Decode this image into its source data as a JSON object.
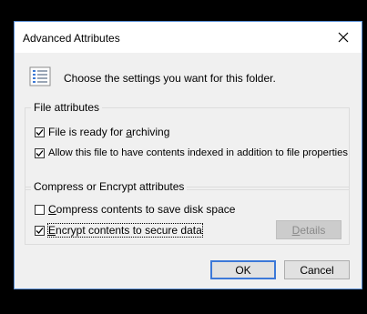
{
  "dialog": {
    "title": "Advanced Attributes",
    "header_text": "Choose the settings you want for this folder."
  },
  "file_attributes": {
    "label": "File attributes",
    "archive": {
      "label_pre": "File is ready for ",
      "label_ul": "a",
      "label_post": "rchiving",
      "checked": true
    },
    "index": {
      "label": "Allow this file to have contents indexed in addition to file properties",
      "checked": true
    }
  },
  "compress_encrypt": {
    "label": "Compress or Encrypt attributes",
    "compress": {
      "label_ul": "C",
      "label_post": "ompress contents to save disk space",
      "checked": false
    },
    "encrypt": {
      "label_ul": "E",
      "label_post": "ncrypt contents to secure data",
      "checked": true
    },
    "details_ul": "D",
    "details_post": "etails"
  },
  "buttons": {
    "ok": "OK",
    "cancel": "Cancel"
  },
  "colors": {
    "accent": "#3c78d8",
    "dialog_bg": "#f0f0f0"
  },
  "icons": {
    "close": "close-icon",
    "folder_settings": "list-settings-icon",
    "check": "check-icon"
  }
}
